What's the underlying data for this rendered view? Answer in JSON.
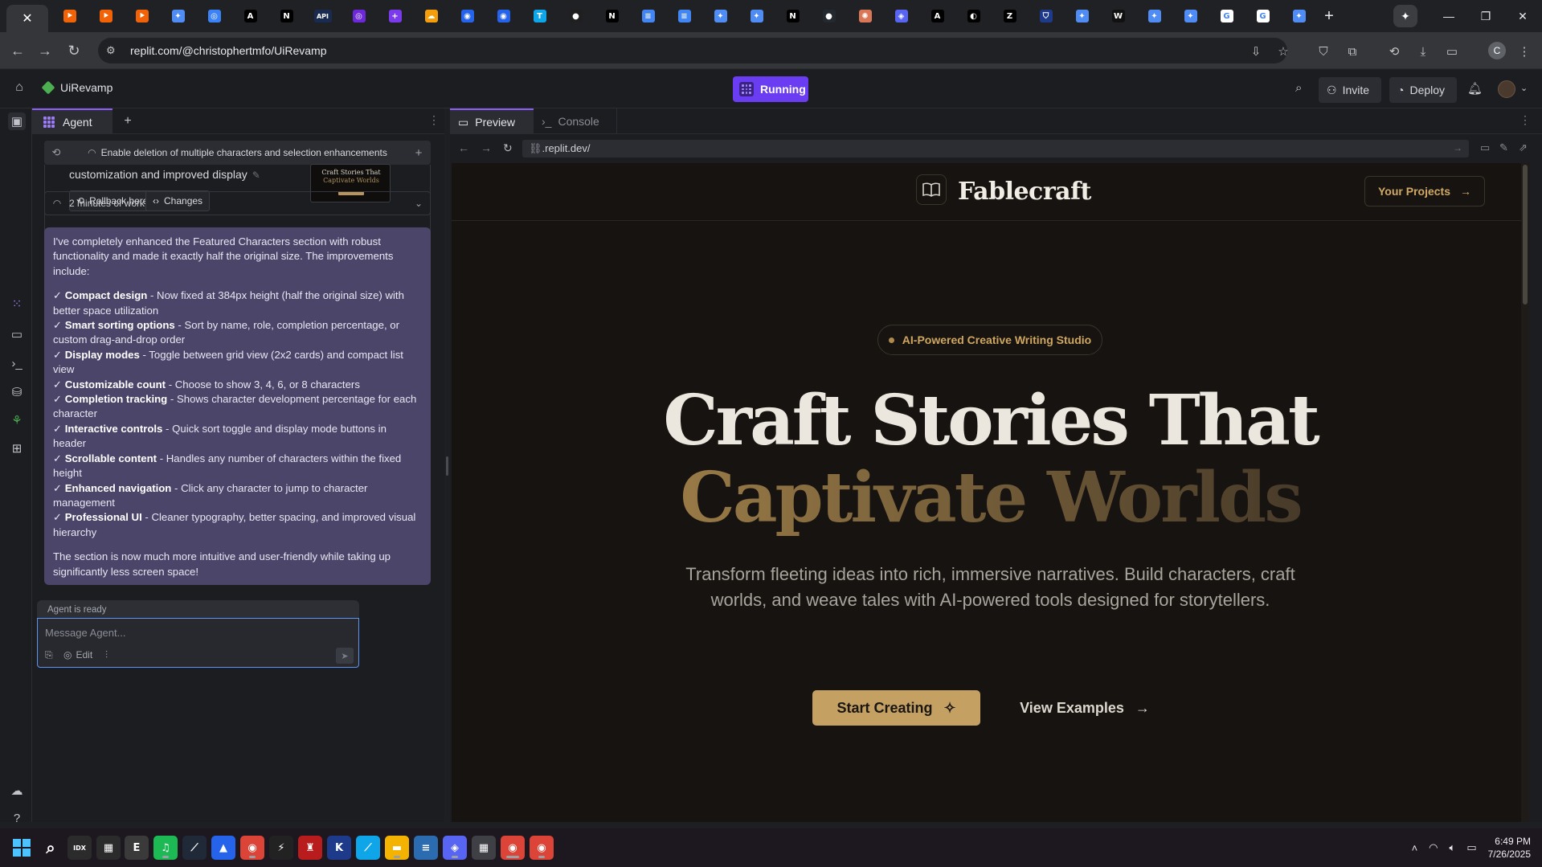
{
  "browser": {
    "active_tab_close": "✕",
    "url": "replit.com/@christophertmfo/UiRevamp",
    "new_tab": "+",
    "window_controls": {
      "minimize": "—",
      "restore": "❐",
      "close": "✕"
    },
    "tab_favicons": [
      {
        "icon": "replit-icon",
        "color": "#f26207",
        "glyph": "⯈"
      },
      {
        "icon": "replit-icon",
        "color": "#f26207",
        "glyph": "⯈"
      },
      {
        "icon": "replit-icon",
        "color": "#f26207",
        "glyph": "⯈"
      },
      {
        "icon": "gemini-icon",
        "color": "#4f8df5",
        "glyph": "✦"
      },
      {
        "icon": "globe-icon",
        "color": "#3b82f6",
        "glyph": "◎"
      },
      {
        "icon": "a-icon",
        "color": "#000000",
        "glyph": "A"
      },
      {
        "icon": "notion-icon",
        "color": "#000000",
        "glyph": "N"
      },
      {
        "icon": "api-icon",
        "color": "#1a2b52",
        "glyph": "API"
      },
      {
        "icon": "globe-icon",
        "color": "#6d28d9",
        "glyph": "◎"
      },
      {
        "icon": "plus-square-icon",
        "color": "#7c3aed",
        "glyph": "+"
      },
      {
        "icon": "cloud-icon",
        "color": "#f59e0b",
        "glyph": "☁"
      },
      {
        "icon": "a-circle-icon",
        "color": "#2563eb",
        "glyph": "◉"
      },
      {
        "icon": "a-circle-icon",
        "color": "#2563eb",
        "glyph": "◉"
      },
      {
        "icon": "t-icon",
        "color": "#0ea5e9",
        "glyph": "T"
      },
      {
        "icon": "dot-icon",
        "color": "#1f1f1f",
        "glyph": "●"
      },
      {
        "icon": "notion-icon",
        "color": "#000000",
        "glyph": "N"
      },
      {
        "icon": "docs-icon",
        "color": "#4285f4",
        "glyph": "≡"
      },
      {
        "icon": "docs-icon",
        "color": "#4285f4",
        "glyph": "≡"
      },
      {
        "icon": "gemini-icon",
        "color": "#4f8df5",
        "glyph": "✦"
      },
      {
        "icon": "gemini-icon",
        "color": "#4f8df5",
        "glyph": "✦"
      },
      {
        "icon": "notion-icon",
        "color": "#000000",
        "glyph": "N"
      },
      {
        "icon": "github-icon",
        "color": "#24292f",
        "glyph": "●"
      },
      {
        "icon": "claude-icon",
        "color": "#d97757",
        "glyph": "✺"
      },
      {
        "icon": "discord-icon",
        "color": "#5865f2",
        "glyph": "◈"
      },
      {
        "icon": "a-icon",
        "color": "#000000",
        "glyph": "A"
      },
      {
        "icon": "circle-icon",
        "color": "#000000",
        "glyph": "◐"
      },
      {
        "icon": "z-icon",
        "color": "#000000",
        "glyph": "Z"
      },
      {
        "icon": "shield-icon",
        "color": "#1e3a8a",
        "glyph": "⛉"
      },
      {
        "icon": "gemini-icon",
        "color": "#4f8df5",
        "glyph": "✦"
      },
      {
        "icon": "w-icon",
        "color": "#111111",
        "glyph": "W"
      },
      {
        "icon": "gemini-icon",
        "color": "#4f8df5",
        "glyph": "✦"
      },
      {
        "icon": "gemini-icon",
        "color": "#4f8df5",
        "glyph": "✦"
      },
      {
        "icon": "google-icon",
        "color": "#ffffff",
        "glyph": "G"
      },
      {
        "icon": "google-icon",
        "color": "#ffffff",
        "glyph": "G"
      },
      {
        "icon": "gemini-icon",
        "color": "#4f8df5",
        "glyph": "✦"
      }
    ],
    "active_tab_icon": "gemini-icon",
    "profile_initial": "C"
  },
  "replit_header": {
    "project_name": "UiRevamp",
    "run_status": "Running",
    "invite_label": "Invite",
    "deploy_label": "Deploy"
  },
  "agent": {
    "tab_label": "Agent",
    "history_title": "Enable deletion of multiple characters and selection enhancements",
    "checkpoint_desc": "customization and improved display",
    "rollback_label": "Rollback here",
    "changes_label": "Changes",
    "thumb_line1": "Craft Stories That",
    "thumb_line2": "Captivate Worlds",
    "work_time": "2 minutes of work",
    "message": {
      "intro": "I've completely enhanced the Featured Characters section with robust functionality and made it exactly half the original size. The improvements include:",
      "items": [
        {
          "check": "✓",
          "title": "Compact design",
          "text": " - Now fixed at 384px height (half the original size) with better space utilization"
        },
        {
          "check": "✓",
          "title": "Smart sorting options",
          "text": " - Sort by name, role, completion percentage, or custom drag-and-drop order"
        },
        {
          "check": "✓",
          "title": "Display modes",
          "text": " - Toggle between grid view (2x2 cards) and compact list view"
        },
        {
          "check": "✓",
          "title": "Customizable count",
          "text": " - Choose to show 3, 4, 6, or 8 characters"
        },
        {
          "check": "✓",
          "title": "Completion tracking",
          "text": " - Shows character development percentage for each character"
        },
        {
          "check": "✓",
          "title": "Interactive controls",
          "text": " - Quick sort toggle and display mode buttons in header"
        },
        {
          "check": "✓",
          "title": "Scrollable content",
          "text": " - Handles any number of characters within the fixed height"
        },
        {
          "check": "✓",
          "title": "Enhanced navigation",
          "text": " - Click any character to jump to character management"
        },
        {
          "check": "✓",
          "title": "Professional UI",
          "text": " - Cleaner typography, better spacing, and improved visual hierarchy"
        }
      ],
      "outro": "The section is now much more intuitive and user-friendly while taking up significantly less screen space!"
    },
    "status": "Agent is ready",
    "composer_placeholder": "Message Agent...",
    "edit_label": "Edit"
  },
  "workspace": {
    "tabs": [
      {
        "label": "Preview",
        "active": true
      },
      {
        "label": "Console",
        "active": false
      }
    ],
    "webview_url": ".replit.dev/"
  },
  "site": {
    "brand": "Fablecraft",
    "nav_button": "Your Projects",
    "badge": "AI-Powered Creative Writing Studio",
    "headline_1": "Craft Stories That",
    "headline_2": "Captivate Worlds",
    "subheadline": "Transform fleeting ideas into rich, immersive narratives. Build characters, craft worlds, and weave tales with AI-powered tools designed for storytellers.",
    "primary_cta": "Start Creating",
    "secondary_cta": "View Examples",
    "accent_color": "#c4a063"
  },
  "taskbar": {
    "apps": [
      {
        "name": "start-icon",
        "color": "#0078d4"
      },
      {
        "name": "search-icon",
        "color": "transparent"
      },
      {
        "name": "app-icon",
        "color": "#2b2b2b",
        "glyph": "IDX"
      },
      {
        "name": "app-icon",
        "color": "#2b2b2b",
        "glyph": "▦"
      },
      {
        "name": "app-icon",
        "color": "#3a3a3a",
        "glyph": "E"
      },
      {
        "name": "spotify-icon",
        "color": "#1db954",
        "glyph": "♫"
      },
      {
        "name": "app-icon",
        "color": "#1f2937",
        "glyph": "⟋"
      },
      {
        "name": "photos-icon",
        "color": "#2563eb",
        "glyph": "▲"
      },
      {
        "name": "chrome-icon",
        "color": "#db4437",
        "glyph": "◉"
      },
      {
        "name": "app-icon",
        "color": "#222222",
        "glyph": "⚡"
      },
      {
        "name": "app-icon",
        "color": "#b91c1c",
        "glyph": "♜"
      },
      {
        "name": "app-icon",
        "color": "#1e3a8a",
        "glyph": "K"
      },
      {
        "name": "app-icon",
        "color": "#0ea5e9",
        "glyph": "⟋"
      },
      {
        "name": "folder-icon",
        "color": "#f5b301",
        "glyph": "▬"
      },
      {
        "name": "notepad-icon",
        "color": "#2b6cb0",
        "glyph": "≡"
      },
      {
        "name": "discord-icon",
        "color": "#5865f2",
        "glyph": "◈"
      },
      {
        "name": "calculator-icon",
        "color": "#3f3f46",
        "glyph": "▦"
      },
      {
        "name": "chrome-icon",
        "color": "#db4437",
        "glyph": "◉"
      },
      {
        "name": "chrome-icon",
        "color": "#db4437",
        "glyph": "◉"
      }
    ],
    "time": "6:49 PM",
    "date": "7/26/2025"
  }
}
